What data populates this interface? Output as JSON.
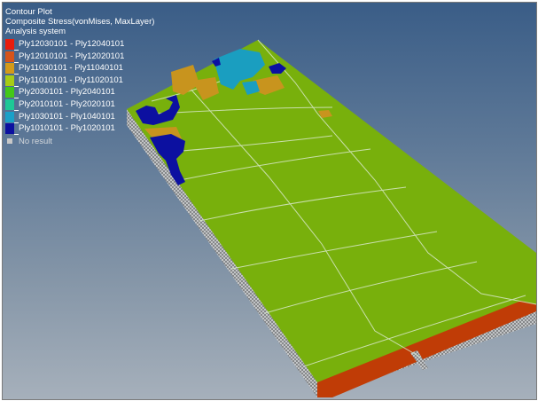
{
  "legend": {
    "title": "Contour Plot",
    "subtitle": "Composite Stress(vonMises, MaxLayer)",
    "system": "Analysis system",
    "items": [
      {
        "label": "Ply12030101 - Ply12040101",
        "color": "#e81c0c"
      },
      {
        "label": "Ply12010101 - Ply12020101",
        "color": "#d6541a"
      },
      {
        "label": "Ply11030101 - Ply11040101",
        "color": "#d49a18"
      },
      {
        "label": "Ply11010101 - Ply11020101",
        "color": "#a8cc14"
      },
      {
        "label": "Ply2030101 - Ply2040101",
        "color": "#44c818"
      },
      {
        "label": "Ply2010101 - Ply2020101",
        "color": "#1ec896"
      },
      {
        "label": "Ply1030101 - Ply1040101",
        "color": "#1aa0c8"
      },
      {
        "label": "Ply1010101 - Ply1020101",
        "color": "#0c10a0"
      }
    ],
    "no_result": {
      "label": "No result",
      "color": "#c8c8c8"
    }
  },
  "model_colors": {
    "top_surface": "#78b00c",
    "skin_end": "#c03c06",
    "mesh_side": "#c9cbcd",
    "dark_blue_patch": "#0c10a0",
    "cyan_patch": "#1a9ec0",
    "orange_patch": "#c8941e"
  }
}
